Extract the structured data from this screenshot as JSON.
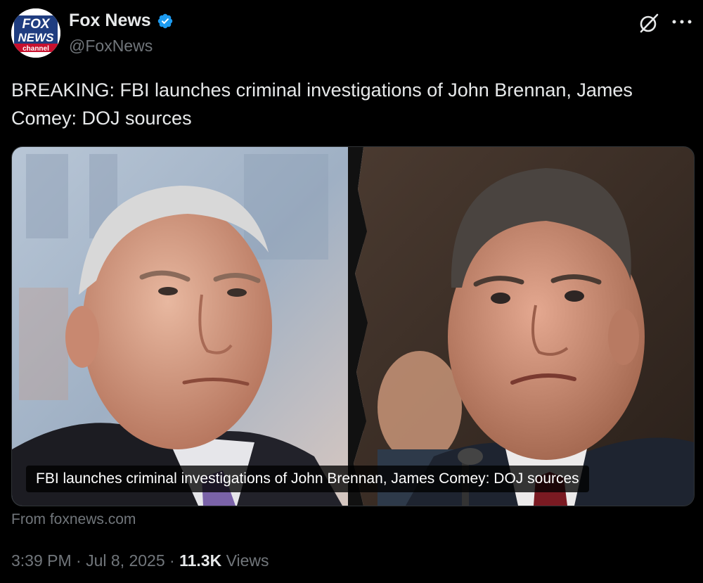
{
  "account": {
    "display_name": "Fox News",
    "handle": "@FoxNews",
    "verified": true,
    "verified_color": "#1d9bf0",
    "avatar_icon": "fox-news-channel-logo-icon",
    "avatar_text_top": "FOX",
    "avatar_text_mid": "NEWS",
    "avatar_text_bottom": "channel"
  },
  "header_actions": {
    "grok_icon": "grok-icon",
    "more_icon": "more-options-icon"
  },
  "tweet": {
    "text": "BREAKING: FBI launches criminal investigations of John Brennan, James Comey: DOJ sources"
  },
  "card": {
    "caption": "FBI launches criminal investigations of John Brennan, James Comey: DOJ sources",
    "source": "From foxnews.com",
    "image_description_left": "photo-of-john-brennan",
    "image_description_right": "photo-of-james-comey"
  },
  "meta": {
    "time": "3:39 PM",
    "separator": "·",
    "date": "Jul 8, 2025",
    "views_count": "11.3K",
    "views_label": "Views"
  },
  "colors": {
    "background": "#000000",
    "text_primary": "#e7e9ea",
    "text_secondary": "#71767b",
    "border": "#2f3336"
  }
}
